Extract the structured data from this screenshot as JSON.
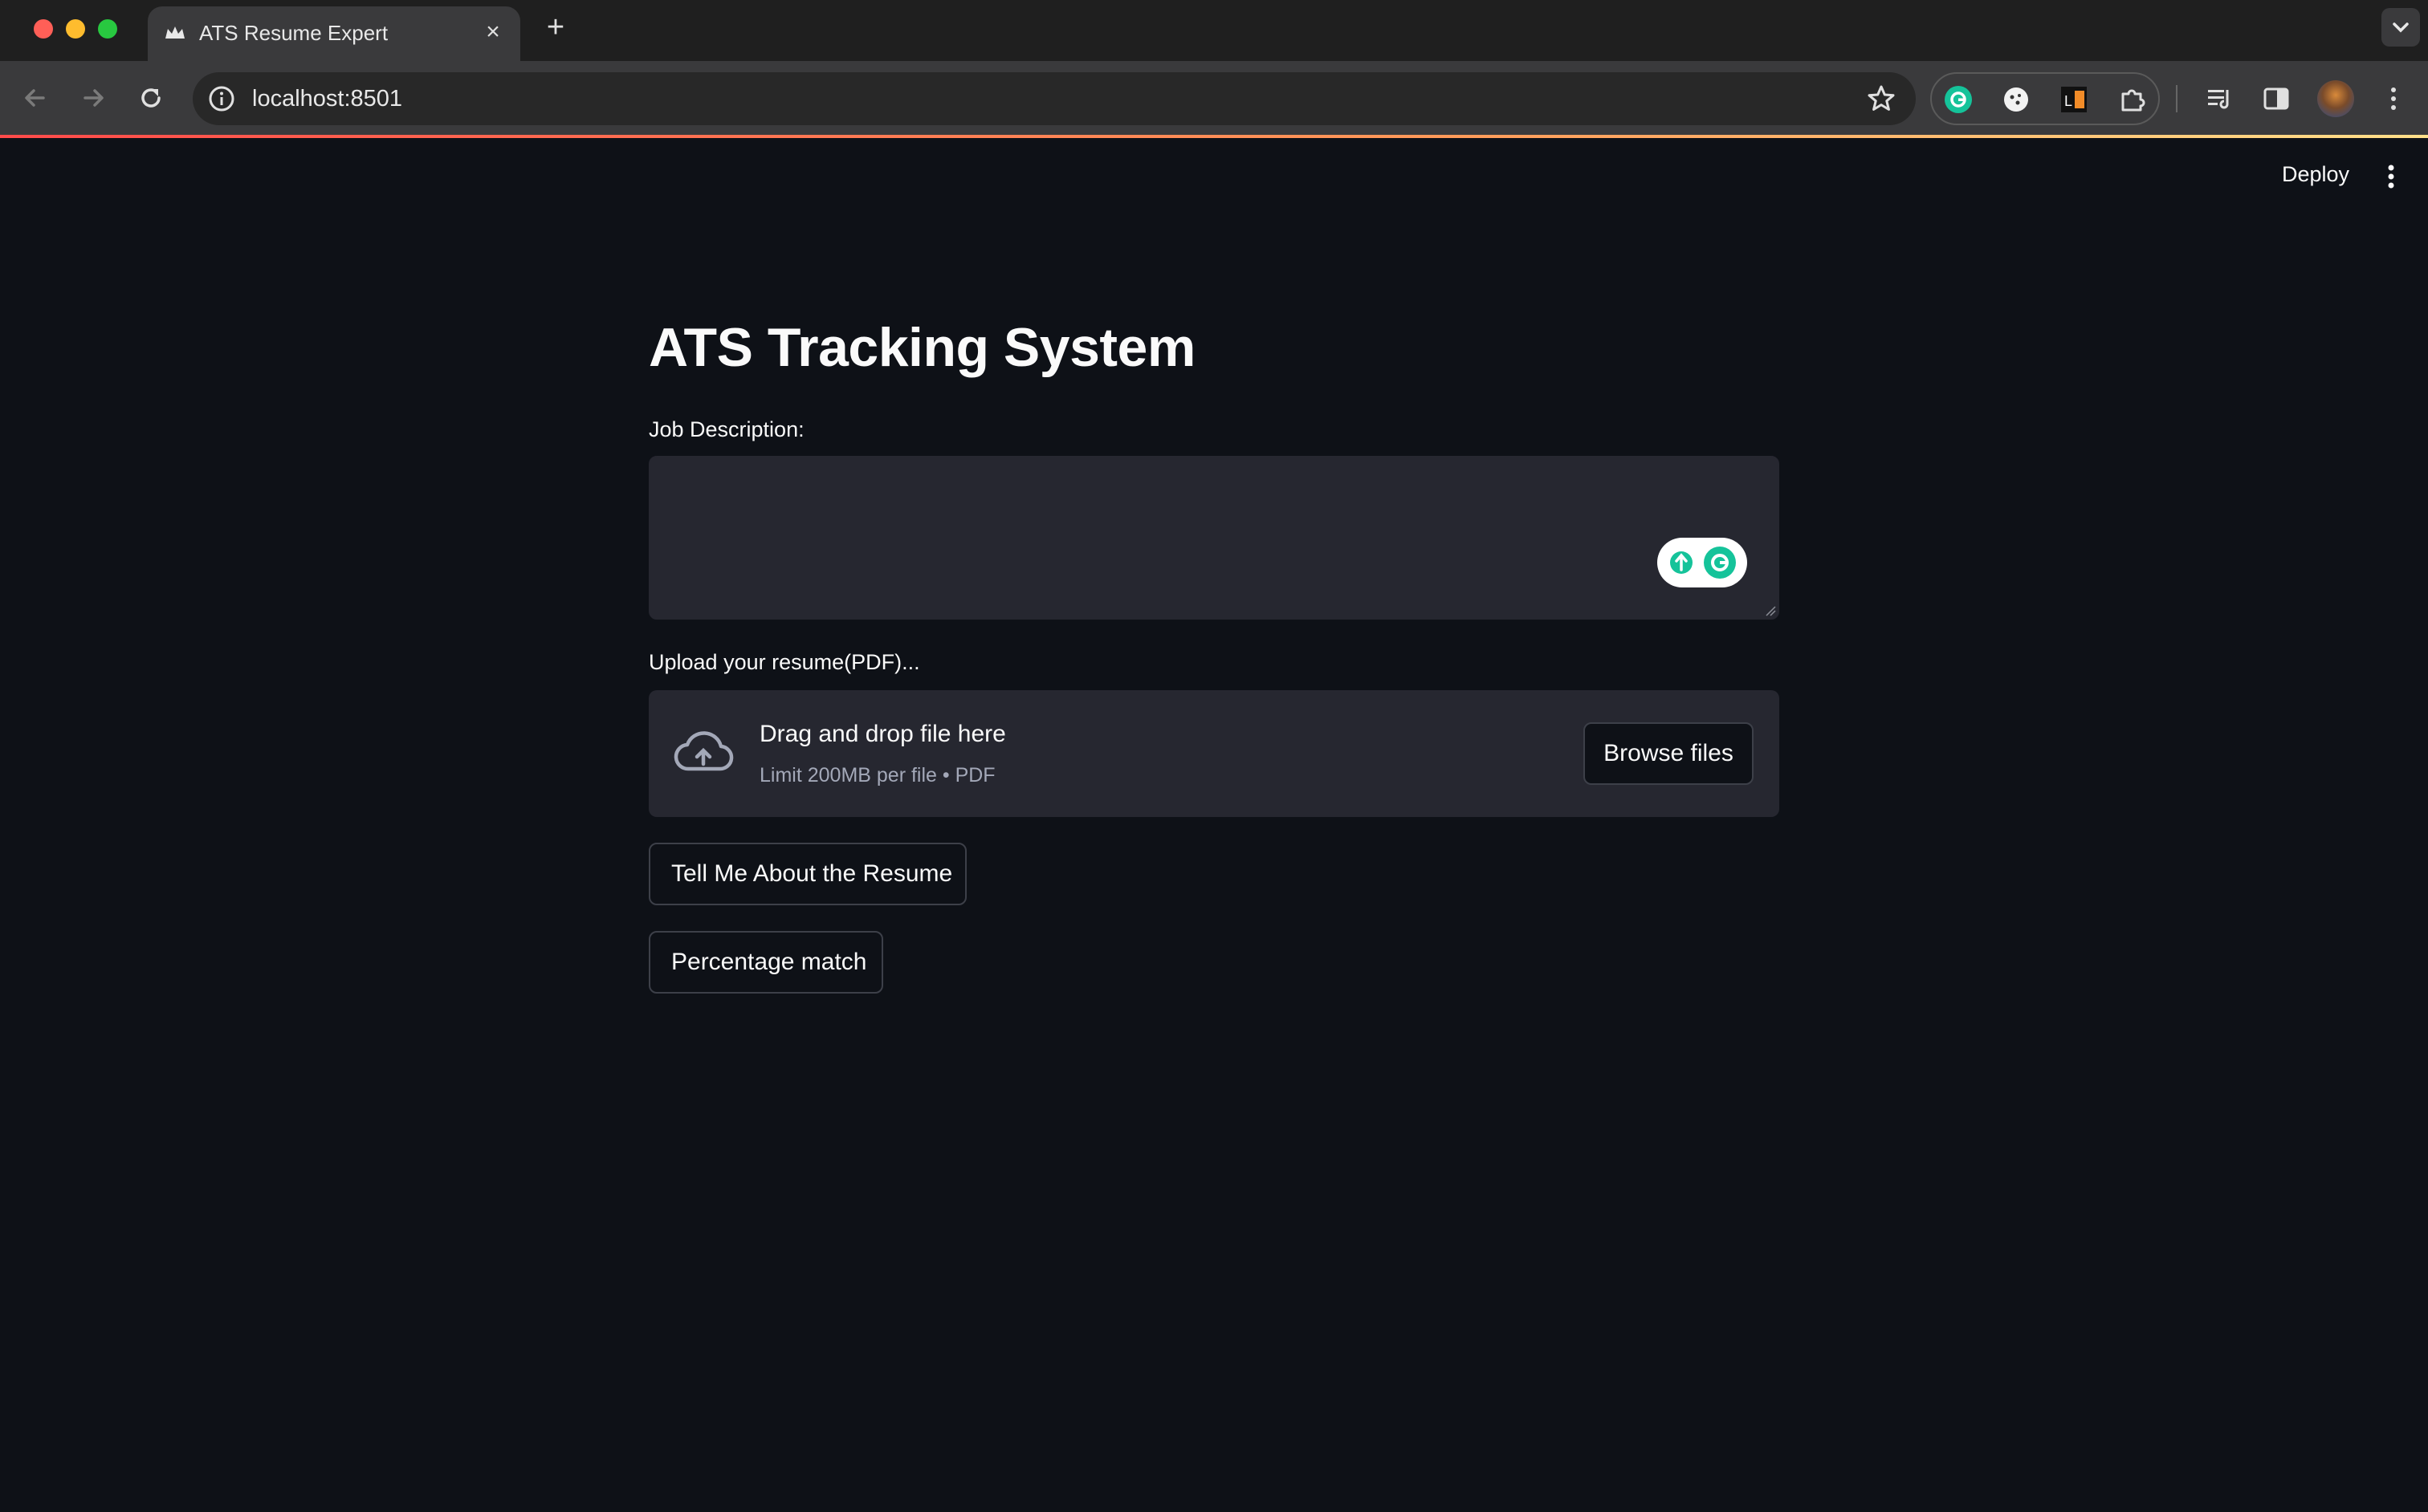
{
  "browser": {
    "tab_title": "ATS Resume Expert",
    "url": "localhost:8501",
    "new_tab_symbol": "+",
    "close_symbol": "×"
  },
  "app": {
    "deploy_label": "Deploy",
    "title": "ATS Tracking System",
    "job_description_label": "Job Description:",
    "job_description_value": "",
    "upload_label": "Upload your resume(PDF)...",
    "dropzone_main": "Drag and drop file here",
    "dropzone_sub": "Limit 200MB per file • PDF",
    "browse_label": "Browse files",
    "buttons": {
      "tell_me": "Tell Me About the Resume",
      "percentage": "Percentage match"
    }
  },
  "colors": {
    "app_background": "#0e1117",
    "widget_background": "#262730",
    "text": "#fafafa",
    "accent_gradient_start": "#ff4b4b",
    "accent_gradient_end": "#ffe08a"
  },
  "icons": [
    "streamlit-crown-icon",
    "close-icon",
    "plus-icon",
    "back-arrow-icon",
    "forward-arrow-icon",
    "reload-icon",
    "site-info-icon",
    "bookmark-star-icon",
    "grammarly-icon",
    "cookie-editor-icon",
    "lighthouse-icon",
    "extensions-puzzle-icon",
    "reading-list-icon",
    "side-panel-icon",
    "kebab-menu-icon",
    "cloud-upload-icon"
  ]
}
